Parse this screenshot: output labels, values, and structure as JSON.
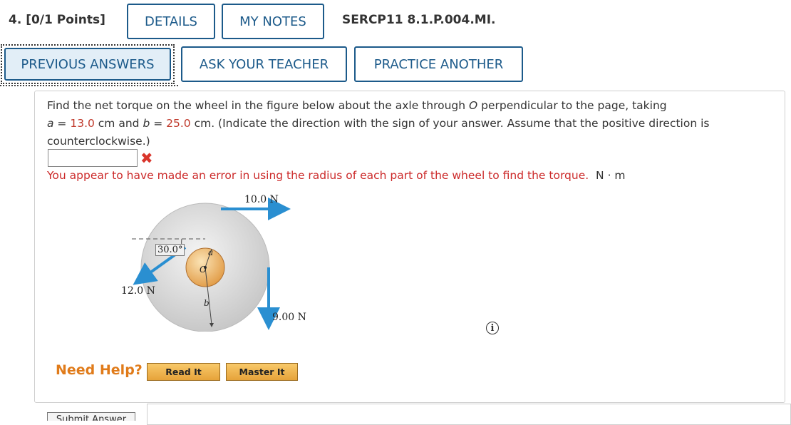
{
  "header": {
    "question_label": "4. [0/1 Points]",
    "details_label": "DETAILS",
    "my_notes_label": "MY NOTES",
    "problem_code": "SERCP11 8.1.P.004.MI."
  },
  "actions": {
    "previous_answers_label": "PREVIOUS ANSWERS",
    "ask_teacher_label": "ASK YOUR TEACHER",
    "practice_another_label": "PRACTICE ANOTHER"
  },
  "question": {
    "text_1": "Find the net torque on the wheel in the figure below about the axle through ",
    "point_o": "O",
    "text_2": " perpendicular to the page, taking",
    "a_label": "a",
    "eq1": " = ",
    "a_value": "13.0",
    "a_unit": " cm and ",
    "b_label": "b",
    "eq2": " = ",
    "b_value": "25.0",
    "b_unit": " cm. (Indicate the direction with the sign of your answer. Assume that the positive direction is counterclockwise.)"
  },
  "answer": {
    "value": "",
    "error_message": "You appear to have made an error in using the radius of each part of the wheel to find the torque.",
    "unit": "N · m"
  },
  "figure": {
    "force_top": "10.0 N",
    "angle": "30.0°",
    "force_left": "12.0 N",
    "force_right": "9.00 N",
    "label_a": "a",
    "label_o": "O",
    "label_b": "b",
    "colors": {
      "arrow": "#2a8fd1",
      "outer": "#d4d4d4",
      "inner": "#e8a857"
    }
  },
  "help": {
    "need_help_label": "Need Help?",
    "read_it_label": "Read It",
    "master_it_label": "Master It"
  },
  "icons": {
    "info": "info-icon",
    "error": "x-mark-icon"
  },
  "footer": {
    "submit_label": "Submit Answer"
  }
}
